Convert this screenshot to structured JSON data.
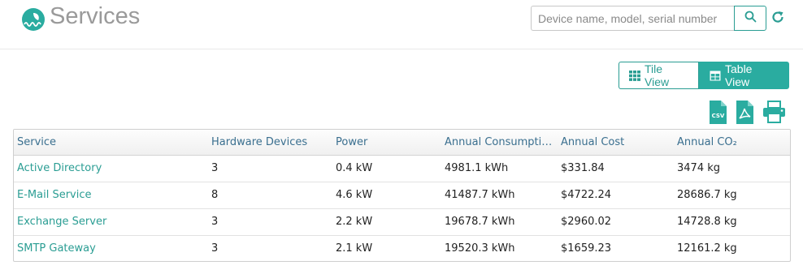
{
  "app": {
    "title": "Services",
    "logo_icon": "leaf-wave-logo-icon",
    "accent": "#2aaca0"
  },
  "search": {
    "placeholder": "Device name, model, serial number",
    "button_icon": "search-icon",
    "refresh_icon": "refresh-icon"
  },
  "view_toggle": {
    "tile_label": "Tile View",
    "table_label": "Table View",
    "active": "Table View"
  },
  "exports": {
    "csv_label": "CSV",
    "items": [
      "csv-icon",
      "pdf-icon",
      "print-icon"
    ]
  },
  "table": {
    "headers": {
      "service": "Service",
      "devices": "Hardware Devices",
      "power": "Power",
      "consumption": "Annual Consumpti…",
      "cost": "Annual Cost",
      "co2": "Annual CO₂"
    },
    "rows": [
      {
        "service": "Active Directory",
        "devices": "3",
        "power": "0.4 kW",
        "consumption": "4981.1 kWh",
        "cost": "$331.84",
        "co2": "3474 kg"
      },
      {
        "service": "E-Mail Service",
        "devices": "8",
        "power": "4.6 kW",
        "consumption": "41487.7 kWh",
        "cost": "$4722.24",
        "co2": "28686.7 kg"
      },
      {
        "service": "Exchange Server",
        "devices": "3",
        "power": "2.2 kW",
        "consumption": "19678.7 kWh",
        "cost": "$2960.02",
        "co2": "14728.8 kg"
      },
      {
        "service": "SMTP Gateway",
        "devices": "3",
        "power": "2.1 kW",
        "consumption": "19520.3 kWh",
        "cost": "$1659.23",
        "co2": "12161.2 kg"
      }
    ]
  }
}
